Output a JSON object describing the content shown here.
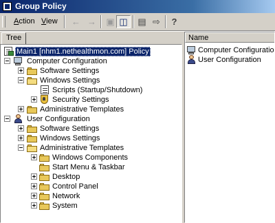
{
  "window": {
    "title": "Group Policy"
  },
  "menu": {
    "action": "Action",
    "view": "View"
  },
  "toolbar": {
    "icons": [
      "back-arrow-icon",
      "forward-arrow-icon",
      "up-folder-icon",
      "show-tree-icon",
      "properties-icon",
      "export-list-icon",
      "help-icon"
    ]
  },
  "left_pane": {
    "tab": "Tree"
  },
  "tree": {
    "root": "Main1 [nhm1.nethealthmon.com] Policy",
    "computer_config": "Computer Configuration",
    "cc_software": "Software Settings",
    "cc_windows": "Windows Settings",
    "cc_scripts": "Scripts (Startup/Shutdown)",
    "cc_security": "Security Settings",
    "cc_admin": "Administrative Templates",
    "user_config": "User Configuration",
    "uc_software": "Software Settings",
    "uc_windows": "Windows Settings",
    "uc_admin": "Administrative Templates",
    "uc_components": "Windows Components",
    "uc_startmenu": "Start Menu & Taskbar",
    "uc_desktop": "Desktop",
    "uc_control": "Control Panel",
    "uc_network": "Network",
    "uc_system": "System"
  },
  "right_pane": {
    "column": "Name",
    "items": [
      "Computer Configuration",
      "User Configuration"
    ]
  },
  "colors": {
    "title_start": "#0a246a",
    "selection": "#0a246a",
    "folder": "#e8c85a"
  }
}
